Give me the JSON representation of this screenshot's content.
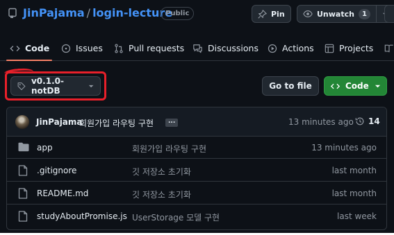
{
  "repo": {
    "owner": "JinPajama",
    "separator": "/",
    "name": "login-lecture",
    "visibility": "Public"
  },
  "header_buttons": {
    "pin": "Pin",
    "watch": "Unwatch",
    "watch_count": "1"
  },
  "nav": {
    "tabs": [
      {
        "label": "Code",
        "icon": "code-icon"
      },
      {
        "label": "Issues",
        "icon": "issue-icon"
      },
      {
        "label": "Pull requests",
        "icon": "pull-request-icon"
      },
      {
        "label": "Discussions",
        "icon": "discussion-icon"
      },
      {
        "label": "Actions",
        "icon": "play-icon"
      },
      {
        "label": "Projects",
        "icon": "table-icon"
      }
    ],
    "active": "Code"
  },
  "branch": {
    "label": "v0.1.0-notDB",
    "icon": "tag-icon"
  },
  "actions": {
    "go_to_file": "Go to file",
    "code": "Code"
  },
  "latest_commit": {
    "author": "JinPajama",
    "message": "회원가입 라우팅 구현",
    "ellipsis": "...",
    "time": "13 minutes ago",
    "commit_count": "14"
  },
  "files": [
    {
      "type": "folder",
      "name": "app",
      "message": "회원가입 라우팅 구현",
      "time": "13 minutes ago"
    },
    {
      "type": "file",
      "name": ".gitignore",
      "message": "깃 저장소 초기화",
      "time": "last month"
    },
    {
      "type": "file",
      "name": "README.md",
      "message": "깃 저장소 초기화",
      "time": "last month"
    },
    {
      "type": "file",
      "name": "studyAboutPromise.js",
      "message": "UserStorage 모델 구현",
      "time": "last week"
    }
  ],
  "colors": {
    "background": "#0d1117",
    "link": "#4493f8",
    "primary_button": "#238636",
    "annotation": "#e8202a",
    "tab_underline": "#f78166"
  }
}
